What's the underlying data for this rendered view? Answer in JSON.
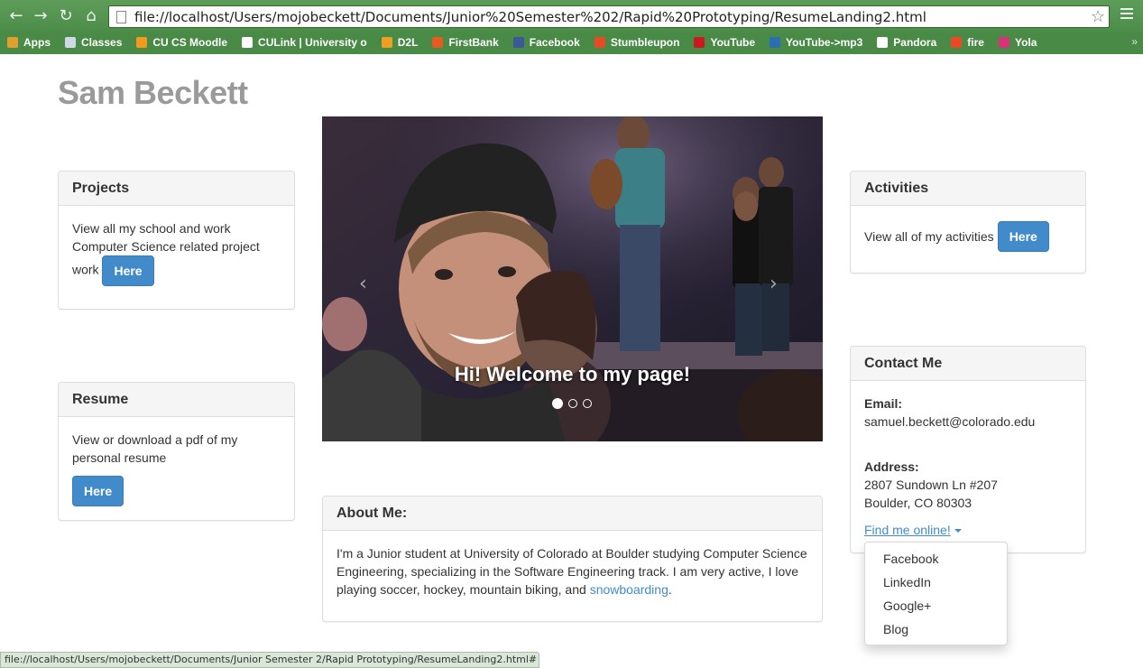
{
  "browser": {
    "url": "file://localhost/Users/mojobeckett/Documents/Junior%20Semester%202/Rapid%20Prototyping/ResumeLanding2.html",
    "status_url": "file://localhost/Users/mojobeckett/Documents/Junior Semester 2/Rapid Prototyping/ResumeLanding2.html#",
    "bookmarks": [
      {
        "label": "Apps",
        "icon": "apps-grid-icon",
        "color": "#e0a030"
      },
      {
        "label": "Classes",
        "icon": "folder-icon",
        "color": "#cfd8e6"
      },
      {
        "label": "CU CS Moodle",
        "icon": "moodle-icon",
        "color": "#f39a1e"
      },
      {
        "label": "CULink | University o",
        "icon": "page-icon",
        "color": "#ffffff"
      },
      {
        "label": "D2L",
        "icon": "d2l-icon",
        "color": "#f0a020"
      },
      {
        "label": "FirstBank",
        "icon": "firstbank-icon",
        "color": "#e85a20"
      },
      {
        "label": "Facebook",
        "icon": "facebook-icon",
        "color": "#3b5998"
      },
      {
        "label": "Stumbleupon",
        "icon": "stumbleupon-icon",
        "color": "#eb4924"
      },
      {
        "label": "YouTube",
        "icon": "youtube-icon",
        "color": "#cc181e"
      },
      {
        "label": "YouTube->mp3",
        "icon": "mp3-icon",
        "color": "#2a6fb5"
      },
      {
        "label": "Pandora",
        "icon": "pandora-icon",
        "color": "#ffffff"
      },
      {
        "label": "fire",
        "icon": "stumbleupon-icon",
        "color": "#eb4924"
      },
      {
        "label": "Yola",
        "icon": "yola-icon",
        "color": "#d8337a"
      }
    ]
  },
  "page": {
    "name": "Sam Beckett",
    "carousel_caption": "Hi! Welcome to my page!",
    "projects": {
      "title": "Projects",
      "text": "View all my school and work Computer Science related project work",
      "button": "Here"
    },
    "resume": {
      "title": "Resume",
      "text": "View or download a pdf of my personal resume",
      "button": "Here"
    },
    "activities": {
      "title": "Activities",
      "text": "View all of my activities",
      "button": "Here"
    },
    "contact": {
      "title": "Contact Me",
      "email_label": "Email:",
      "email": "samuel.beckett@colorado.edu",
      "address_label": "Address:",
      "address_line1": "2807 Sundown Ln #207",
      "address_line2": "Boulder, CO 80303",
      "find_online": "Find me online!",
      "dropdown": [
        "Facebook",
        "LinkedIn",
        "Google+",
        "Blog"
      ]
    },
    "about": {
      "title": "About Me:",
      "text": "I'm a Junior student at University of Colorado at Boulder studying Computer Science Engineering, specializing in the Software Engineering track. I am very active, I love playing soccer, hockey, mountain biking, and ",
      "link": "snowboarding",
      "tail": "."
    }
  }
}
